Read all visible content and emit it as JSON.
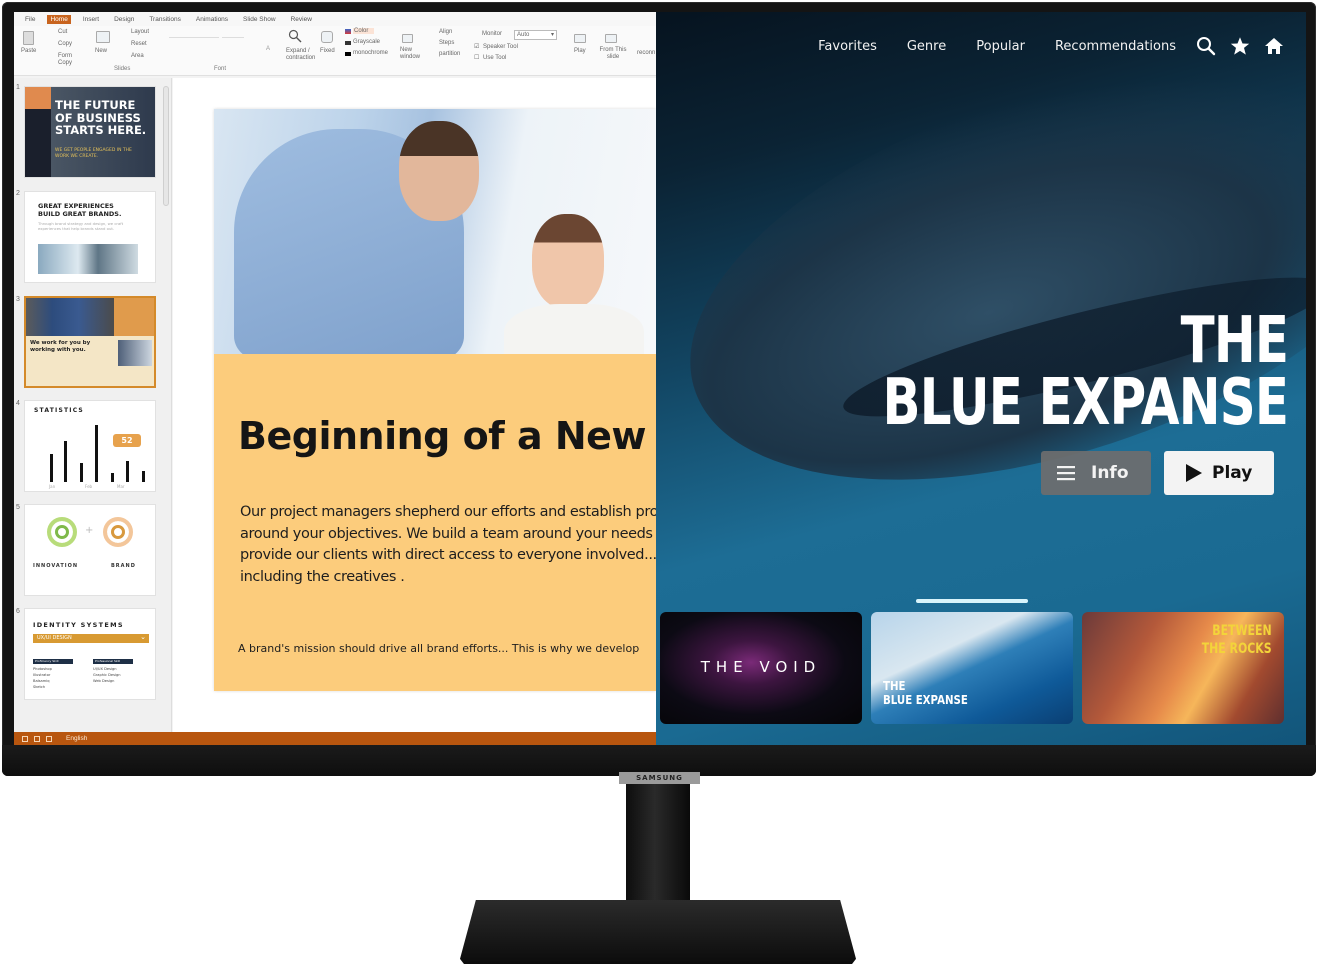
{
  "monitor": {
    "brand": "SAMSUNG"
  },
  "presentation_app": {
    "menu_tabs": [
      {
        "label": "File",
        "active": false
      },
      {
        "label": "Home",
        "active": true
      },
      {
        "label": "Insert",
        "active": false
      },
      {
        "label": "Design",
        "active": false
      },
      {
        "label": "Transitions",
        "active": false
      },
      {
        "label": "Animations",
        "active": false
      },
      {
        "label": "Slide Show",
        "active": false
      },
      {
        "label": "Review",
        "active": false
      }
    ],
    "ribbon": {
      "paste": "Paste",
      "cut": "Cut",
      "copy": "Copy",
      "format_copy": "Form Copy",
      "new_slide": "New",
      "layout": "Layout",
      "reset": "Reset",
      "area": "Area",
      "slides_group": "Slides",
      "font_group": "Font",
      "expand": "Expand / contraction",
      "fixed": "Fixed",
      "color": "Color",
      "grayscale": "Grayscale",
      "monochrome": "monochrome",
      "new_window": "New window",
      "align": "Align",
      "steps": "Steps",
      "partition": "partition",
      "monitor": "Monitor",
      "monitor_value": "Auto",
      "speaker_tool": "Speaker Tool",
      "use_tool": "Use Tool",
      "play": "Play",
      "from_this_slide": "From This slide",
      "reconnect": "reconn"
    },
    "thumbnails": [
      {
        "number": "1",
        "title": "THE FUTURE OF BUSINESS STARTS HERE.",
        "subtitle": "WE GET PEOPLE ENGAGED IN THE WORK WE CREATE."
      },
      {
        "number": "2",
        "title": "GREAT EXPERIENCES BUILD GREAT BRANDS.",
        "subtitle": "Through brand strategy and design, we craft experiences that help brands stand out."
      },
      {
        "number": "3",
        "title": "We work for you by working with you.",
        "selected": true
      },
      {
        "number": "4",
        "title": "STATISTICS",
        "callout": "52",
        "months": [
          "Jan",
          "Feb",
          "Mar"
        ]
      },
      {
        "number": "5",
        "left_label": "INNOVATION",
        "right_label": "BRAND"
      },
      {
        "number": "6",
        "title": "IDENTITY SYSTEMS",
        "dropdown": "UX/UI DESIGN",
        "col1_header": "Proficiency Skill",
        "col2_header": "Professional Skill",
        "col1_items": [
          "Photoshop",
          "Illustrator",
          "Balsamiq",
          "Sketch"
        ],
        "col2_items": [
          "UI/UX Design",
          "Graphic Design",
          "Web Design"
        ]
      }
    ],
    "slide": {
      "title": "Beginning of a New E",
      "body_lines": [
        "Our project managers shepherd our efforts and establish project",
        "around your objectives. We build a team around your needs and",
        "provide our clients with direct access to everyone involved...",
        "including the creatives ."
      ],
      "footer": "A brand's mission should drive all brand efforts... This is why we develop"
    },
    "status": {
      "language": "English"
    },
    "accent_color": "#c8641e"
  },
  "streaming_app": {
    "nav": [
      "Favorites",
      "Genre",
      "Popular",
      "Recommendations"
    ],
    "icons": [
      "search-icon",
      "star-icon",
      "home-icon"
    ],
    "hero": {
      "title_line1": "THE",
      "title_line2": "BLUE EXPANSE"
    },
    "buttons": {
      "info": "Info",
      "play": "Play"
    },
    "cards": [
      {
        "title": "THE VOID"
      },
      {
        "title_line1": "THE",
        "title_line2": "BLUE EXPANSE"
      },
      {
        "title_line1": "BETWEEN",
        "title_line2": "THE ROCKS"
      }
    ]
  }
}
